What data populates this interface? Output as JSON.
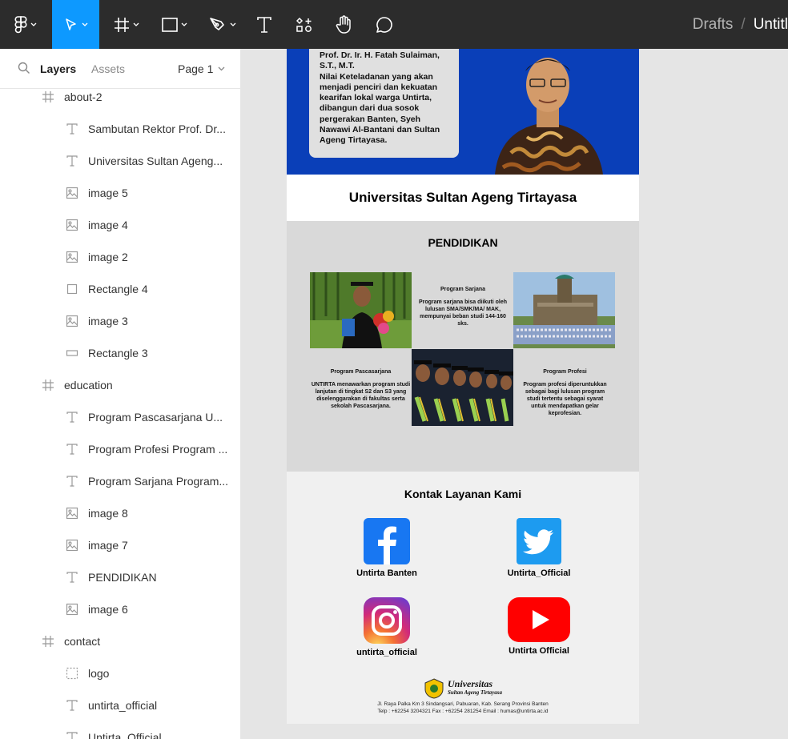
{
  "toolbar": {
    "tools": [
      "main-menu",
      "move",
      "frame",
      "shape",
      "pen",
      "text",
      "resources",
      "hand",
      "comment"
    ],
    "active_tool": "move",
    "accent": "#0d99ff",
    "breadcrumb": {
      "drafts": "Drafts",
      "separator": "/",
      "file_title": "Untitl"
    }
  },
  "panel": {
    "tabs": {
      "layers": "Layers",
      "assets": "Assets"
    },
    "page": "Page 1",
    "layers": [
      {
        "icon": "frame",
        "name": "about-2",
        "indent": 0
      },
      {
        "icon": "text",
        "name": "Sambutan Rektor Prof. Dr...",
        "indent": 1
      },
      {
        "icon": "text",
        "name": "Universitas Sultan Ageng...",
        "indent": 1
      },
      {
        "icon": "image",
        "name": "image 5",
        "indent": 1
      },
      {
        "icon": "image",
        "name": "image 4",
        "indent": 1
      },
      {
        "icon": "image",
        "name": "image 2",
        "indent": 1
      },
      {
        "icon": "rectangle",
        "name": "Rectangle 4",
        "indent": 1
      },
      {
        "icon": "image",
        "name": "image 3",
        "indent": 1
      },
      {
        "icon": "rectangle-wide",
        "name": "Rectangle 3",
        "indent": 1
      },
      {
        "icon": "frame",
        "name": "education",
        "indent": 0
      },
      {
        "icon": "text",
        "name": "Program Pascasarjana U...",
        "indent": 1
      },
      {
        "icon": "text",
        "name": "Program Profesi Program ...",
        "indent": 1
      },
      {
        "icon": "text",
        "name": "Program Sarjana Program...",
        "indent": 1
      },
      {
        "icon": "image",
        "name": "image 8",
        "indent": 1
      },
      {
        "icon": "image",
        "name": "image 7",
        "indent": 1
      },
      {
        "icon": "text",
        "name": "PENDIDIKAN",
        "indent": 1
      },
      {
        "icon": "image",
        "name": "image 6",
        "indent": 1
      },
      {
        "icon": "frame",
        "name": "contact",
        "indent": 0
      },
      {
        "icon": "group",
        "name": "logo",
        "indent": 1
      },
      {
        "icon": "text",
        "name": "untirta_official",
        "indent": 1
      },
      {
        "icon": "text",
        "name": "Untirta_Official",
        "indent": 1
      }
    ]
  },
  "design": {
    "hero": {
      "name": "Prof. Dr. Ir. H. Fatah Sulaiman, S.T., M.T.",
      "text": "Nilai Keteladanan yang akan menjadi penciri dan kekuatan kearifan lokal warga Untirta, dibangun dari dua sosok pergerakan Banten, Syeh Nawawi Al-Bantani dan Sultan Ageng Tirtayasa.",
      "bg": "#0a3fb8"
    },
    "university": "Universitas Sultan Ageng Tirtayasa",
    "education": {
      "title": "PENDIDIKAN",
      "sarjana": {
        "title": "Program Sarjana",
        "text": "Program sarjana bisa diikuti oleh lulusan SMA/SMK/MA/ MAK, mempunyai beban studi 144-160 sks."
      },
      "pascasarjana": {
        "title": "Program Pascasarjana",
        "text": "UNTIRTA menawarkan program studi lanjutan di tingkat S2 dan S3 yang diselenggarakan di fakultas serta sekolah Pascasarjana."
      },
      "profesi": {
        "title": "Program Profesi",
        "text": "Program profesi diperuntukkan sebagai bagi lulusan program studi tertentu sebagai syarat untuk mendapatkan gelar keprofesian."
      }
    },
    "contact": {
      "title": "Kontak Layanan Kami",
      "facebook": "Untirta Banten",
      "twitter": "Untirta_Official",
      "instagram": "untirta_official",
      "youtube": "Untirta Official",
      "logo_title": "Universitas",
      "logo_subtitle": "Sultan Ageng Tirtayasa",
      "address": "Jl. Raya Palka Km 3 Sindangsari, Pabuaran, Kab. Serang Provinsi Banten",
      "phone": "Telp : +62254 3204321 Fax : +62254 281254 Email : humas@untirta.ac.id"
    }
  }
}
